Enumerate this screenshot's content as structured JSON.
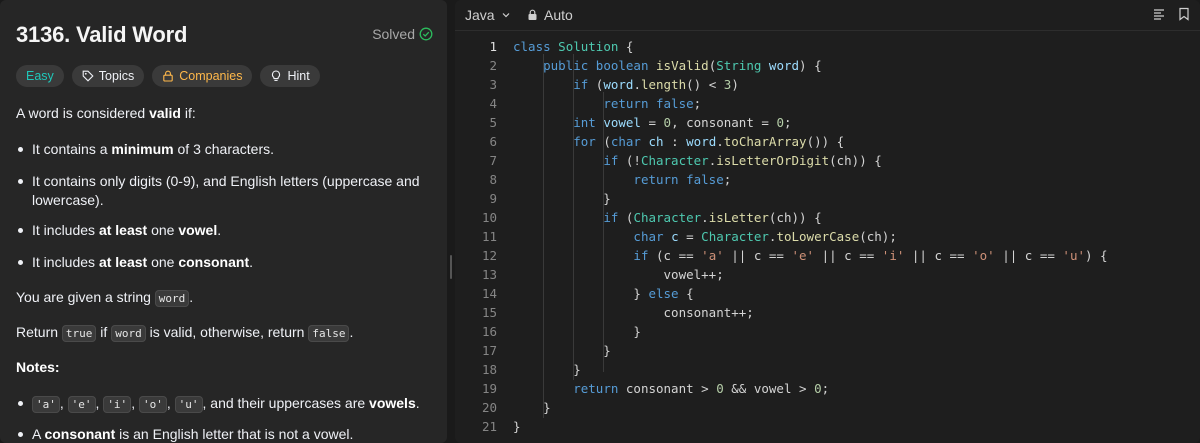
{
  "problem": {
    "title": "3136. Valid Word",
    "status": "Solved",
    "tags": [
      "Easy",
      "Topics",
      "Companies",
      "Hint"
    ],
    "description": {
      "intro_pre": "A word is considered ",
      "intro_bold": "valid",
      "intro_post": " if:",
      "rules": [
        {
          "pre": "It contains a ",
          "bold": "minimum",
          "post": " of 3 characters."
        },
        {
          "pre": "It contains only digits (0-9), and English letters (uppercase and lowercase).",
          "bold": "",
          "post": ""
        },
        {
          "pre": "It includes ",
          "bold": "at least",
          "mid": " one ",
          "bold2": "vowel",
          "post": "."
        },
        {
          "pre": "It includes ",
          "bold": "at least",
          "mid": " one ",
          "bold2": "consonant",
          "post": "."
        }
      ],
      "given_pre": "You are given a string ",
      "given_code": "word",
      "given_post": ".",
      "return_pre": "Return ",
      "return_code1": "true",
      "return_mid1": " if ",
      "return_code2": "word",
      "return_mid2": " is valid, otherwise, return ",
      "return_code3": "false",
      "return_post": ".",
      "notes_label": "Notes:",
      "note1_codes": [
        "'a'",
        "'e'",
        "'i'",
        "'o'",
        "'u'"
      ],
      "note1_sep": ", ",
      "note1_mid": ", and their uppercases are ",
      "note1_bold": "vowels",
      "note1_post": ".",
      "note2_pre": "A ",
      "note2_bold": "consonant",
      "note2_post": " is an English letter that is not a vowel."
    }
  },
  "editor": {
    "language": "Java",
    "mode": "Auto",
    "colors": {
      "keyword": "#569cd6",
      "type": "#4ec9b0",
      "function": "#dcdcaa",
      "variable": "#9cdcfe",
      "number": "#b5cea8",
      "string": "#ce9178"
    },
    "lines": [
      [
        [
          "kw",
          "class"
        ],
        [
          "pl",
          " "
        ],
        [
          "ty",
          "Solution"
        ],
        [
          "pl",
          " {"
        ]
      ],
      [
        [
          "pl",
          "    "
        ],
        [
          "kw",
          "public"
        ],
        [
          "pl",
          " "
        ],
        [
          "kw",
          "boolean"
        ],
        [
          "pl",
          " "
        ],
        [
          "fn",
          "isValid"
        ],
        [
          "pl",
          "("
        ],
        [
          "ty",
          "String"
        ],
        [
          "pl",
          " "
        ],
        [
          "vr",
          "word"
        ],
        [
          "pl",
          ") {"
        ]
      ],
      [
        [
          "pl",
          "        "
        ],
        [
          "kw",
          "if"
        ],
        [
          "pl",
          " ("
        ],
        [
          "vr",
          "word"
        ],
        [
          "pl",
          "."
        ],
        [
          "fn",
          "length"
        ],
        [
          "pl",
          "() < "
        ],
        [
          "nm",
          "3"
        ],
        [
          "pl",
          ")"
        ]
      ],
      [
        [
          "pl",
          "            "
        ],
        [
          "kw",
          "return"
        ],
        [
          "pl",
          " "
        ],
        [
          "kw",
          "false"
        ],
        [
          "pl",
          ";"
        ]
      ],
      [
        [
          "pl",
          "        "
        ],
        [
          "kw",
          "int"
        ],
        [
          "pl",
          " "
        ],
        [
          "vr",
          "vowel"
        ],
        [
          "pl",
          " = "
        ],
        [
          "nm",
          "0"
        ],
        [
          "pl",
          ", consonant = "
        ],
        [
          "nm",
          "0"
        ],
        [
          "pl",
          ";"
        ]
      ],
      [
        [
          "pl",
          "        "
        ],
        [
          "kw",
          "for"
        ],
        [
          "pl",
          " ("
        ],
        [
          "kw",
          "char"
        ],
        [
          "pl",
          " "
        ],
        [
          "vr",
          "ch"
        ],
        [
          "pl",
          " : "
        ],
        [
          "vr",
          "word"
        ],
        [
          "pl",
          "."
        ],
        [
          "fn",
          "toCharArray"
        ],
        [
          "pl",
          "()) {"
        ]
      ],
      [
        [
          "pl",
          "            "
        ],
        [
          "kw",
          "if"
        ],
        [
          "pl",
          " (!"
        ],
        [
          "ty",
          "Character"
        ],
        [
          "pl",
          "."
        ],
        [
          "fn",
          "isLetterOrDigit"
        ],
        [
          "pl",
          "(ch)) {"
        ]
      ],
      [
        [
          "pl",
          "                "
        ],
        [
          "kw",
          "return"
        ],
        [
          "pl",
          " "
        ],
        [
          "kw",
          "false"
        ],
        [
          "pl",
          ";"
        ]
      ],
      [
        [
          "pl",
          "            }"
        ]
      ],
      [
        [
          "pl",
          "            "
        ],
        [
          "kw",
          "if"
        ],
        [
          "pl",
          " ("
        ],
        [
          "ty",
          "Character"
        ],
        [
          "pl",
          "."
        ],
        [
          "fn",
          "isLetter"
        ],
        [
          "pl",
          "(ch)) {"
        ]
      ],
      [
        [
          "pl",
          "                "
        ],
        [
          "kw",
          "char"
        ],
        [
          "pl",
          " "
        ],
        [
          "vr",
          "c"
        ],
        [
          "pl",
          " = "
        ],
        [
          "ty",
          "Character"
        ],
        [
          "pl",
          "."
        ],
        [
          "fn",
          "toLowerCase"
        ],
        [
          "pl",
          "(ch);"
        ]
      ],
      [
        [
          "pl",
          "                "
        ],
        [
          "kw",
          "if"
        ],
        [
          "pl",
          " (c == "
        ],
        [
          "st",
          "'a'"
        ],
        [
          "pl",
          " || c == "
        ],
        [
          "st",
          "'e'"
        ],
        [
          "pl",
          " || c == "
        ],
        [
          "st",
          "'i'"
        ],
        [
          "pl",
          " || c == "
        ],
        [
          "st",
          "'o'"
        ],
        [
          "pl",
          " || c == "
        ],
        [
          "st",
          "'u'"
        ],
        [
          "pl",
          ") {"
        ]
      ],
      [
        [
          "pl",
          "                    vowel++;"
        ]
      ],
      [
        [
          "pl",
          "                } "
        ],
        [
          "kw",
          "else"
        ],
        [
          "pl",
          " {"
        ]
      ],
      [
        [
          "pl",
          "                    consonant++;"
        ]
      ],
      [
        [
          "pl",
          "                }"
        ]
      ],
      [
        [
          "pl",
          "            }"
        ]
      ],
      [
        [
          "pl",
          "        }"
        ]
      ],
      [
        [
          "pl",
          "        "
        ],
        [
          "kw",
          "return"
        ],
        [
          "pl",
          " consonant > "
        ],
        [
          "nm",
          "0"
        ],
        [
          "pl",
          " && vowel > "
        ],
        [
          "nm",
          "0"
        ],
        [
          "pl",
          ";"
        ]
      ],
      [
        [
          "pl",
          "    }"
        ]
      ],
      [
        [
          "pl",
          "}"
        ]
      ]
    ],
    "line_numbers": [
      "1",
      "2",
      "3",
      "4",
      "5",
      "6",
      "7",
      "8",
      "9",
      "10",
      "11",
      "12",
      "13",
      "14",
      "15",
      "16",
      "17",
      "18",
      "19",
      "20",
      "21"
    ]
  }
}
